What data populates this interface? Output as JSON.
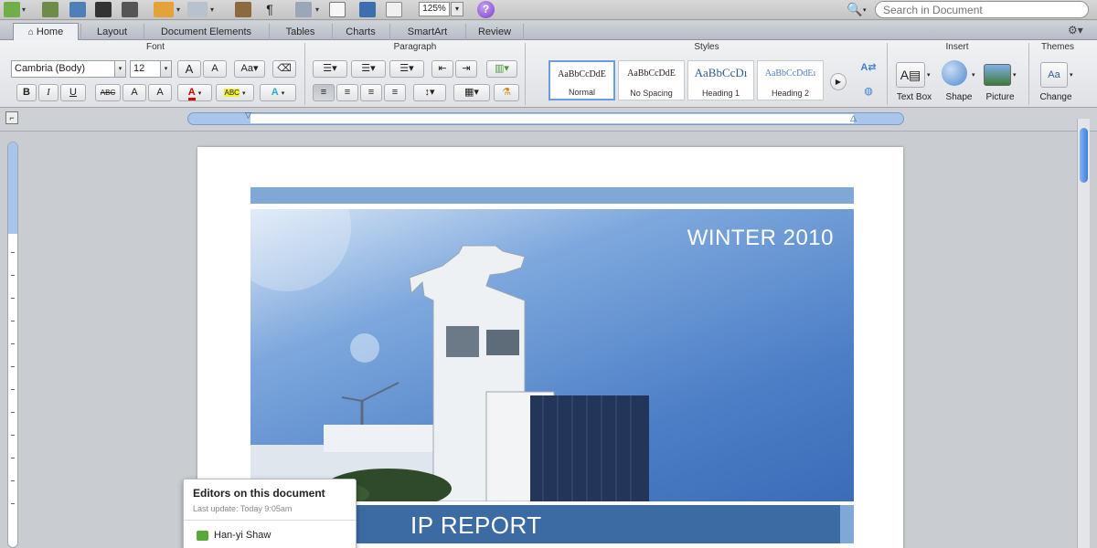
{
  "toolbar": {
    "zoom": "125%",
    "help": "?",
    "search_placeholder": "Search in Document"
  },
  "tabs": [
    {
      "label": "Home"
    },
    {
      "label": "Layout"
    },
    {
      "label": "Document Elements"
    },
    {
      "label": "Tables"
    },
    {
      "label": "Charts"
    },
    {
      "label": "SmartArt"
    },
    {
      "label": "Review"
    }
  ],
  "ribbon": {
    "groups": {
      "font": "Font",
      "paragraph": "Paragraph",
      "styles": "Styles",
      "insert": "Insert",
      "themes": "Themes"
    },
    "font_name": "Cambria (Body)",
    "font_size": "12",
    "font_grow": "A",
    "font_shrink": "A",
    "bold": "B",
    "italic": "I",
    "underline": "U",
    "strike": "ABC",
    "superscript": "A",
    "subscript": "A",
    "font_color": "A",
    "highlight": "ABC",
    "text_effects": "A",
    "styles": [
      {
        "sample": "AaBbCcDdE",
        "name": "Normal"
      },
      {
        "sample": "AaBbCcDdE",
        "name": "No Spacing"
      },
      {
        "sample": "AaBbCcDı",
        "name": "Heading 1"
      },
      {
        "sample": "AaBbCcDdEı",
        "name": "Heading 2"
      }
    ],
    "insert": {
      "text_box": "Text Box",
      "shape": "Shape",
      "picture": "Picture"
    },
    "themes_change": "Change"
  },
  "document": {
    "cover_heading": "WINTER 2010",
    "title": "IP REPORT"
  },
  "editors_popup": {
    "title": "Editors on this document",
    "last_update": "Last update: Today 9:05am",
    "editor": "Han-yi Shaw"
  },
  "colors": {
    "accent_blue": "#3c6aa3",
    "light_band": "#7fa8d6",
    "help_purple": "#7d3bc9"
  }
}
